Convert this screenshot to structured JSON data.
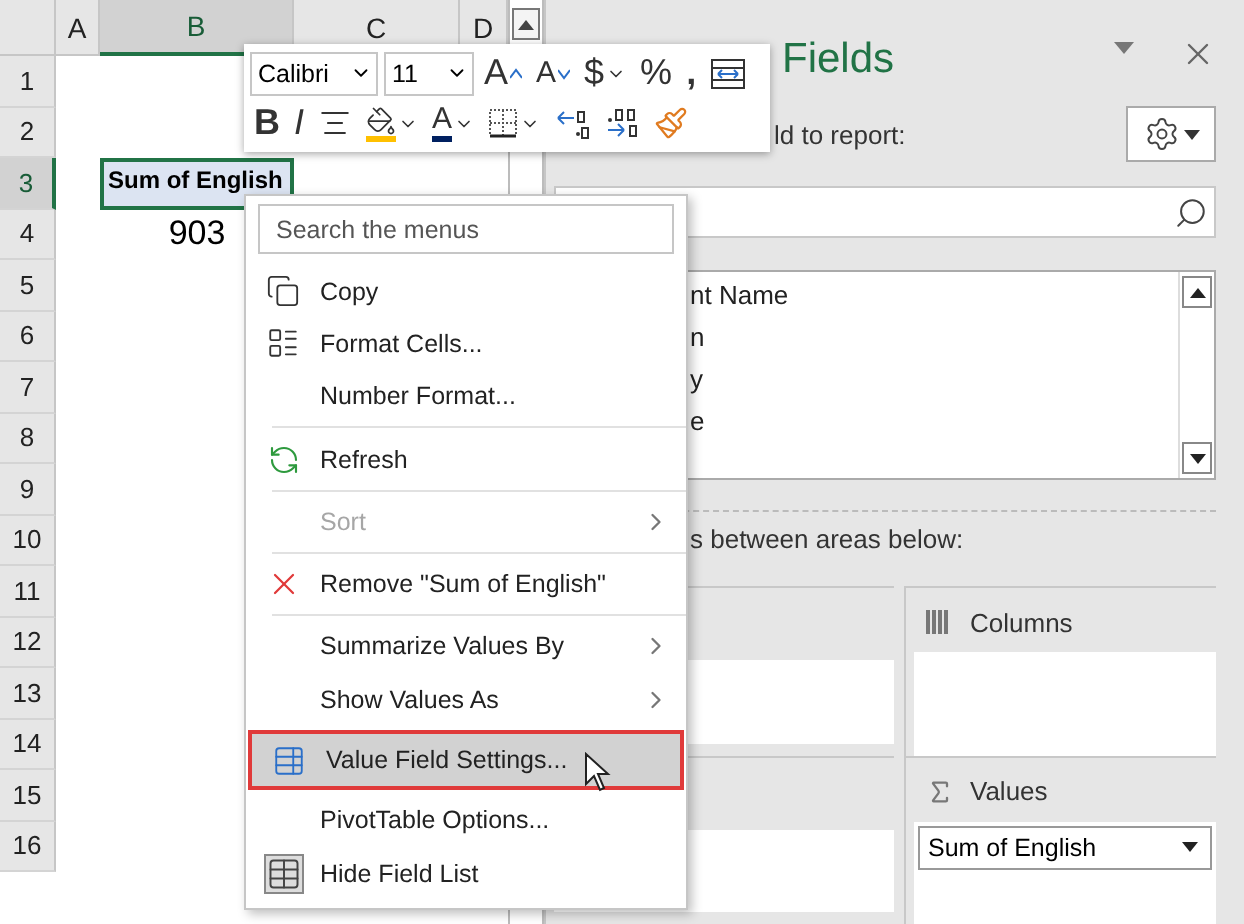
{
  "sheet": {
    "columns": [
      {
        "label": "A",
        "selected": false
      },
      {
        "label": "B",
        "selected": true
      },
      {
        "label": "C",
        "selected": false
      },
      {
        "label": "D",
        "selected": false
      }
    ],
    "rows": [
      {
        "label": "1",
        "selected": false
      },
      {
        "label": "2",
        "selected": false
      },
      {
        "label": "3",
        "selected": true,
        "cells": [
          {
            "kind": "pivot_header",
            "text": "Sum of English",
            "active": true
          }
        ]
      },
      {
        "label": "4",
        "selected": false,
        "cells": [
          {
            "kind": "value",
            "text": "903",
            "active": false
          }
        ]
      },
      {
        "label": "5",
        "selected": false
      },
      {
        "label": "6",
        "selected": false
      },
      {
        "label": "7",
        "selected": false
      },
      {
        "label": "8",
        "selected": false
      },
      {
        "label": "9",
        "selected": false
      },
      {
        "label": "10",
        "selected": false
      },
      {
        "label": "11",
        "selected": false
      },
      {
        "label": "12",
        "selected": false
      },
      {
        "label": "13",
        "selected": false
      },
      {
        "label": "14",
        "selected": false
      },
      {
        "label": "15",
        "selected": false
      },
      {
        "label": "16",
        "selected": false
      }
    ]
  },
  "mini_toolbar": {
    "font": "Calibri",
    "size": "11",
    "row1": [
      {
        "kind": "grow",
        "label": "A"
      },
      {
        "kind": "shrink",
        "label": "A"
      },
      {
        "kind": "currency",
        "label": "$"
      },
      {
        "kind": "percent",
        "label": "%"
      },
      {
        "kind": "comma",
        "label": ","
      },
      {
        "kind": "wrap"
      }
    ],
    "row2": [
      {
        "kind": "bold",
        "label": "B"
      },
      {
        "kind": "italic",
        "label": "I"
      },
      {
        "kind": "center"
      },
      {
        "kind": "fill"
      },
      {
        "kind": "fontcolor",
        "label": "A"
      },
      {
        "kind": "borders"
      },
      {
        "kind": "dec_less"
      },
      {
        "kind": "dec_more"
      },
      {
        "kind": "painter"
      }
    ]
  },
  "context_menu": {
    "search_placeholder": "Search the menus",
    "items": [
      {
        "label": "Copy",
        "disabled": false,
        "submenu": false,
        "selected": false,
        "separator_before": false
      },
      {
        "label": "Format Cells...",
        "disabled": false,
        "submenu": false,
        "selected": false,
        "separator_before": false
      },
      {
        "label": "Number Format...",
        "disabled": false,
        "submenu": false,
        "selected": false,
        "separator_before": false
      },
      {
        "label": "Refresh",
        "disabled": false,
        "submenu": false,
        "selected": false,
        "separator_before": true
      },
      {
        "label": "Sort",
        "disabled": true,
        "submenu": true,
        "selected": false,
        "separator_before": true
      },
      {
        "label": "Remove \"Sum of English\"",
        "disabled": false,
        "submenu": false,
        "selected": false,
        "separator_before": true
      },
      {
        "label": "Summarize Values By",
        "disabled": false,
        "submenu": true,
        "selected": false,
        "separator_before": true
      },
      {
        "label": "Show Values As",
        "disabled": false,
        "submenu": true,
        "selected": false,
        "separator_before": false
      },
      {
        "label": "Value Field Settings...",
        "disabled": false,
        "submenu": false,
        "selected": true,
        "separator_before": false
      },
      {
        "label": "PivotTable Options...",
        "disabled": false,
        "submenu": false,
        "selected": false,
        "separator_before": false
      },
      {
        "label": "Hide Field List",
        "disabled": false,
        "submenu": false,
        "selected": false,
        "separator_before": false
      }
    ]
  },
  "pane": {
    "title": "Fields",
    "subtitle": "ld to report:",
    "fields": [
      {
        "label": "nt Name"
      },
      {
        "label": "n"
      },
      {
        "label": "y"
      },
      {
        "label": "e"
      }
    ],
    "drag_hint": "s between areas below:",
    "areas": [
      {
        "kind": "columns",
        "label": "Columns"
      },
      {
        "kind": "values",
        "label": "Values",
        "items": [
          "Sum of English"
        ]
      }
    ]
  }
}
